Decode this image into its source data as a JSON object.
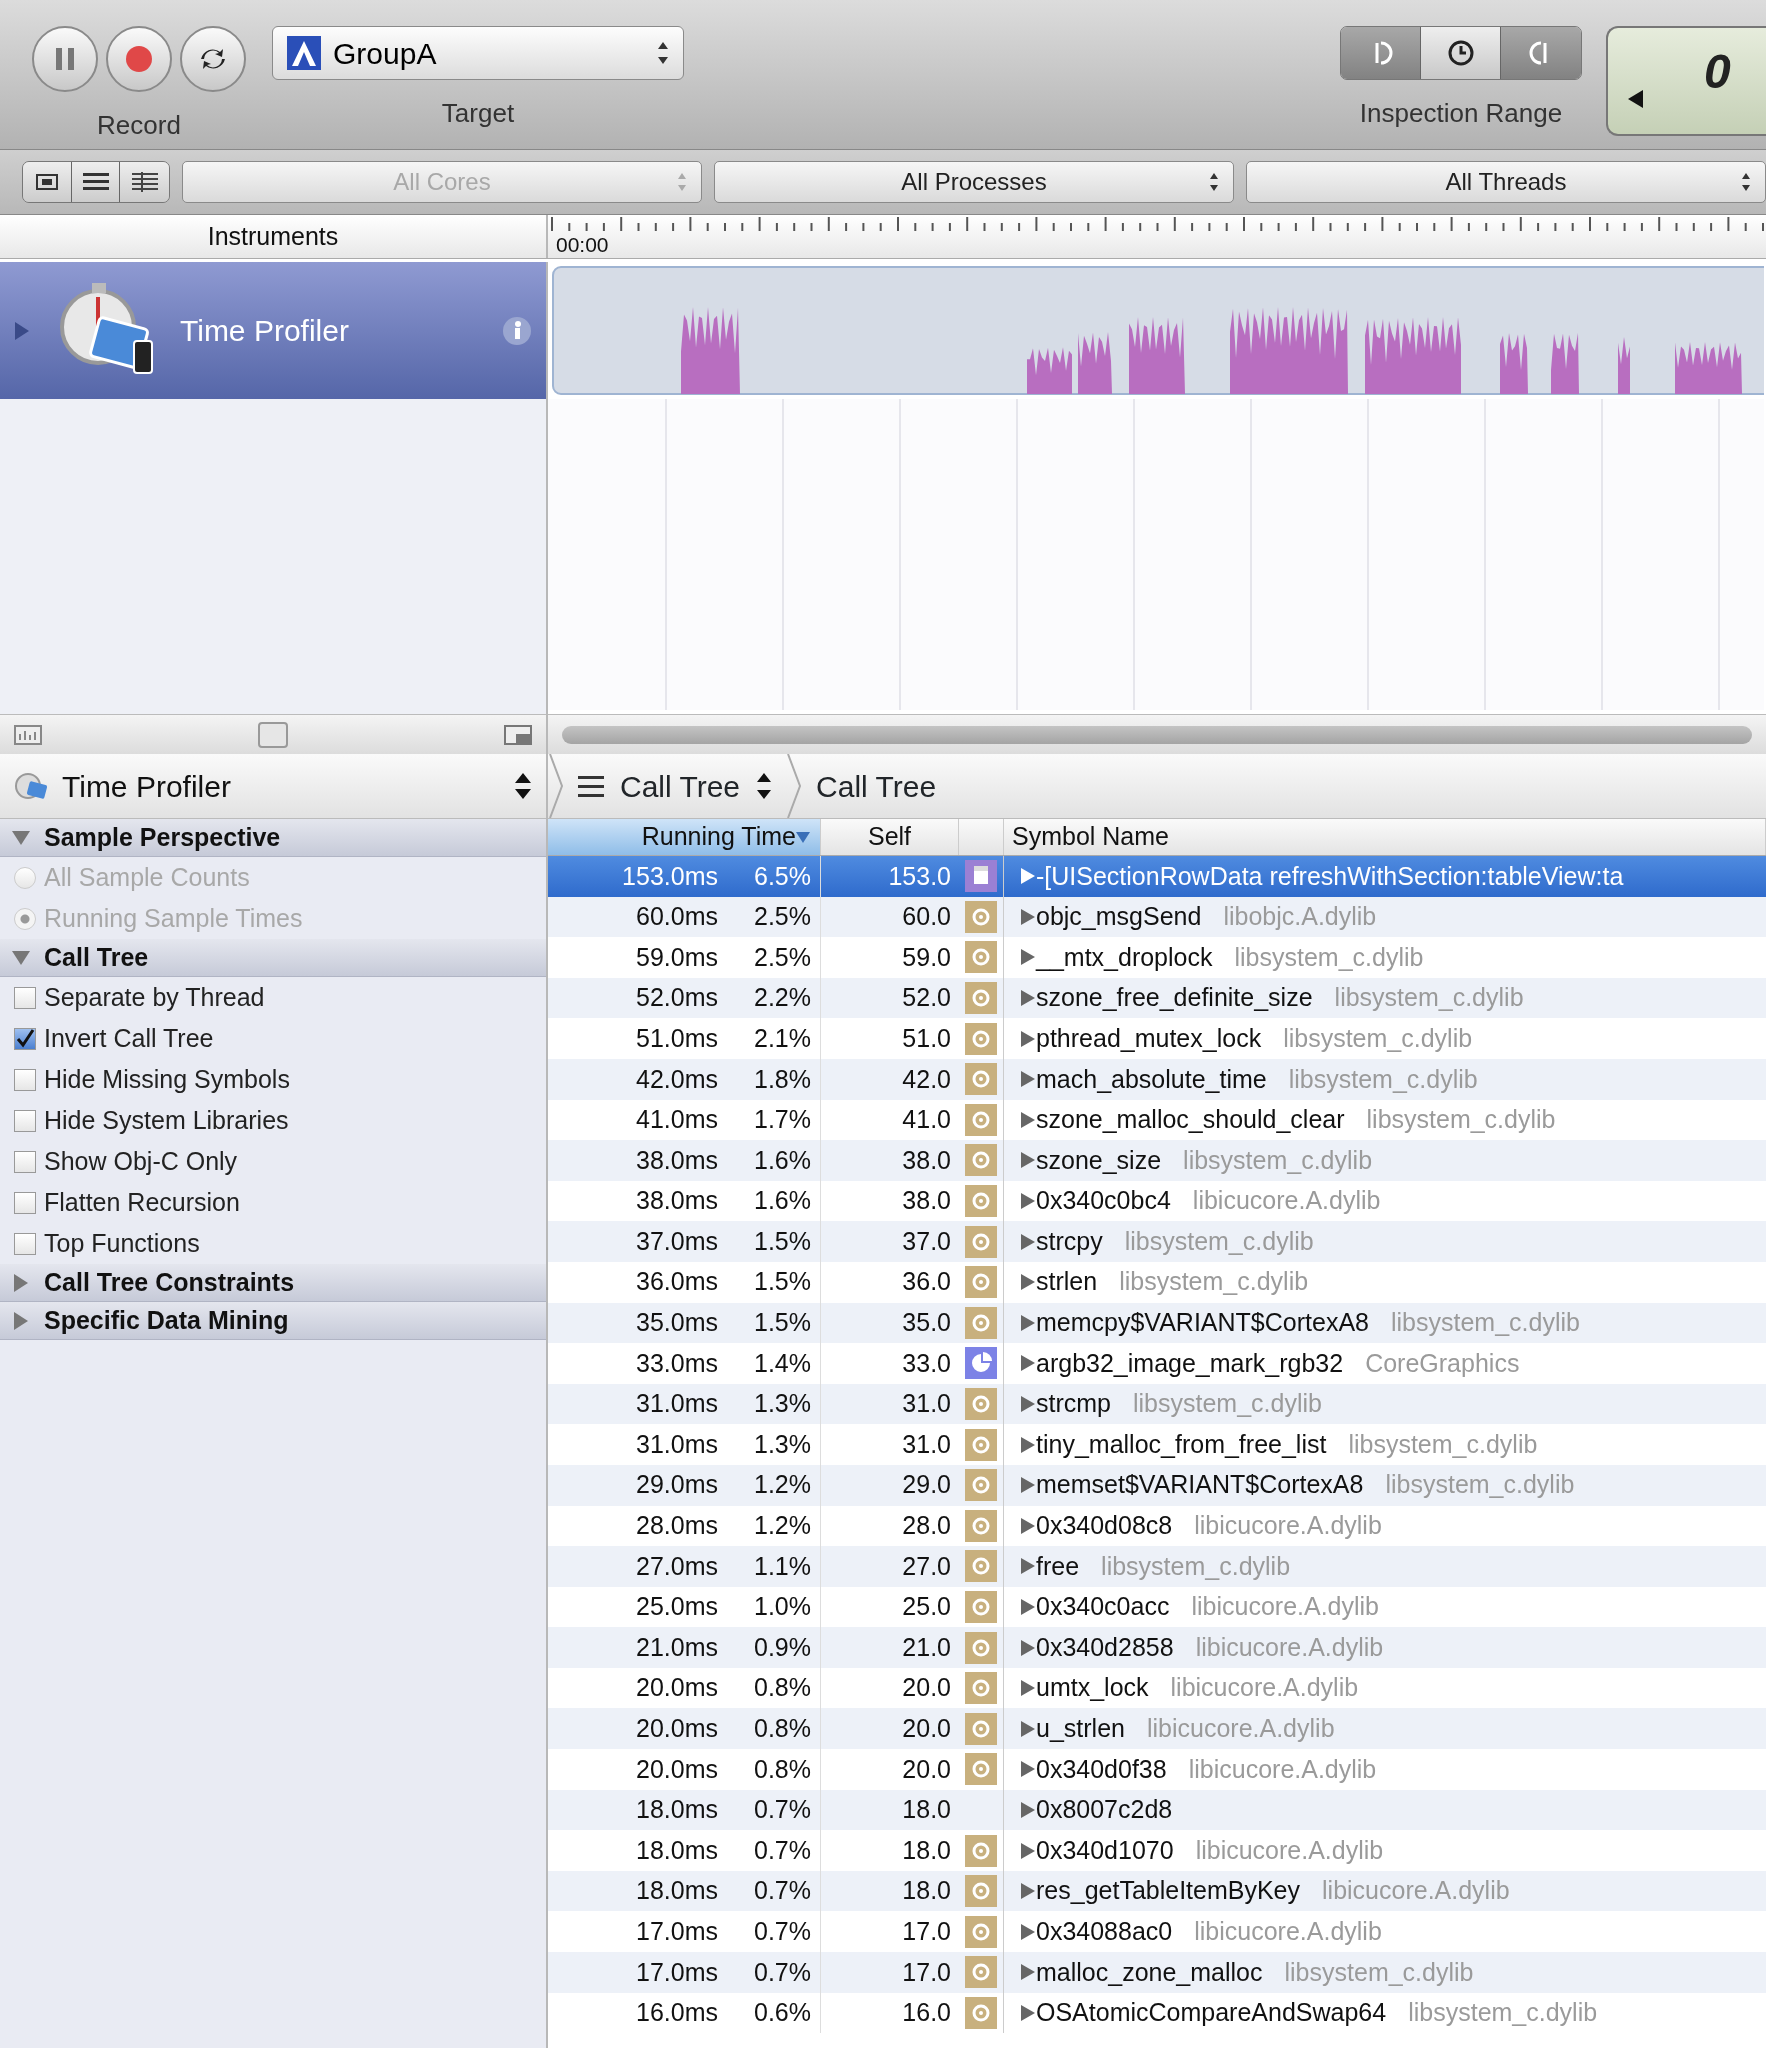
{
  "toolbar": {
    "record_label": "Record",
    "target": {
      "value": "GroupA",
      "label": "Target"
    },
    "inspection_range_label": "Inspection Range",
    "clock_display": "0"
  },
  "filters": [
    {
      "label": "All Cores",
      "disabled": true
    },
    {
      "label": "All Processes",
      "disabled": false
    },
    {
      "label": "All Threads",
      "disabled": false
    }
  ],
  "instruments_header": "Instruments",
  "timeline": {
    "start": "00:00"
  },
  "track": {
    "name": "Time Profiler",
    "selected": true
  },
  "detail_bar": {
    "instrument": "Time Profiler",
    "crumbs": [
      {
        "label": "Call Tree",
        "kind": "popup"
      },
      {
        "label": "Call Tree",
        "kind": "plain"
      }
    ]
  },
  "sidebar": {
    "sections": [
      {
        "title": "Sample Perspective",
        "expanded": true,
        "items": [
          {
            "kind": "radio",
            "label": "All Sample Counts",
            "selected": false,
            "disabled": true
          },
          {
            "kind": "radio",
            "label": "Running Sample Times",
            "selected": true,
            "disabled": true
          }
        ]
      },
      {
        "title": "Call Tree",
        "expanded": true,
        "items": [
          {
            "kind": "checkbox",
            "label": "Separate by Thread",
            "checked": false,
            "disabled": false
          },
          {
            "kind": "checkbox",
            "label": "Invert Call Tree",
            "checked": true,
            "disabled": false
          },
          {
            "kind": "checkbox",
            "label": "Hide Missing Symbols",
            "checked": false,
            "disabled": false
          },
          {
            "kind": "checkbox",
            "label": "Hide System Libraries",
            "checked": false,
            "disabled": false
          },
          {
            "kind": "checkbox",
            "label": "Show Obj-C Only",
            "checked": false,
            "disabled": false
          },
          {
            "kind": "checkbox",
            "label": "Flatten Recursion",
            "checked": false,
            "disabled": false
          },
          {
            "kind": "checkbox",
            "label": "Top Functions",
            "checked": false,
            "disabled": false
          }
        ]
      },
      {
        "title": "Call Tree Constraints",
        "expanded": false
      },
      {
        "title": "Specific Data Mining",
        "expanded": false
      }
    ]
  },
  "table": {
    "columns": [
      {
        "label": "Running Time",
        "sorted": true
      },
      {
        "label": "Self",
        "sorted": false
      },
      {
        "label": "Symbol Name",
        "sorted": false
      }
    ],
    "rows": [
      {
        "time": "153.0ms",
        "percent": "6.5%",
        "self": "153.0",
        "kind": "app",
        "symbol": "-[UISectionRowData refreshWithSection:tableView:ta",
        "selected": true
      },
      {
        "time": "60.0ms",
        "percent": "2.5%",
        "self": "60.0",
        "kind": "system",
        "symbol": "objc_msgSend",
        "library": "libobjc.A.dylib",
        "selected": false
      },
      {
        "time": "59.0ms",
        "percent": "2.5%",
        "self": "59.0",
        "kind": "system",
        "symbol": "__mtx_droplock",
        "library": "libsystem_c.dylib",
        "selected": false
      },
      {
        "time": "52.0ms",
        "percent": "2.2%",
        "self": "52.0",
        "kind": "system",
        "symbol": "szone_free_definite_size",
        "library": "libsystem_c.dylib",
        "selected": false
      },
      {
        "time": "51.0ms",
        "percent": "2.1%",
        "self": "51.0",
        "kind": "system",
        "symbol": "pthread_mutex_lock",
        "library": "libsystem_c.dylib",
        "selected": false
      },
      {
        "time": "42.0ms",
        "percent": "1.8%",
        "self": "42.0",
        "kind": "system",
        "symbol": "mach_absolute_time",
        "library": "libsystem_c.dylib",
        "selected": false
      },
      {
        "time": "41.0ms",
        "percent": "1.7%",
        "self": "41.0",
        "kind": "system",
        "symbol": "szone_malloc_should_clear",
        "library": "libsystem_c.dylib",
        "selected": false
      },
      {
        "time": "38.0ms",
        "percent": "1.6%",
        "self": "38.0",
        "kind": "system",
        "symbol": "szone_size",
        "library": "libsystem_c.dylib",
        "selected": false
      },
      {
        "time": "38.0ms",
        "percent": "1.6%",
        "self": "38.0",
        "kind": "system",
        "symbol": "0x340c0bc4",
        "library": "libicucore.A.dylib",
        "selected": false
      },
      {
        "time": "37.0ms",
        "percent": "1.5%",
        "self": "37.0",
        "kind": "system",
        "symbol": "strcpy",
        "library": "libsystem_c.dylib",
        "selected": false
      },
      {
        "time": "36.0ms",
        "percent": "1.5%",
        "self": "36.0",
        "kind": "system",
        "symbol": "strlen",
        "library": "libsystem_c.dylib",
        "selected": false
      },
      {
        "time": "35.0ms",
        "percent": "1.5%",
        "self": "35.0",
        "kind": "system",
        "symbol": "memcpy$VARIANT$CortexA8",
        "library": "libsystem_c.dylib",
        "selected": false
      },
      {
        "time": "33.0ms",
        "percent": "1.4%",
        "self": "33.0",
        "kind": "graphics",
        "symbol": "argb32_image_mark_rgb32",
        "library": "CoreGraphics",
        "selected": false
      },
      {
        "time": "31.0ms",
        "percent": "1.3%",
        "self": "31.0",
        "kind": "system",
        "symbol": "strcmp",
        "library": "libsystem_c.dylib",
        "selected": false
      },
      {
        "time": "31.0ms",
        "percent": "1.3%",
        "self": "31.0",
        "kind": "system",
        "symbol": "tiny_malloc_from_free_list",
        "library": "libsystem_c.dylib",
        "selected": false
      },
      {
        "time": "29.0ms",
        "percent": "1.2%",
        "self": "29.0",
        "kind": "system",
        "symbol": "memset$VARIANT$CortexA8",
        "library": "libsystem_c.dylib",
        "selected": false
      },
      {
        "time": "28.0ms",
        "percent": "1.2%",
        "self": "28.0",
        "kind": "system",
        "symbol": "0x340d08c8",
        "library": "libicucore.A.dylib",
        "selected": false
      },
      {
        "time": "27.0ms",
        "percent": "1.1%",
        "self": "27.0",
        "kind": "system",
        "symbol": "free",
        "library": "libsystem_c.dylib",
        "selected": false
      },
      {
        "time": "25.0ms",
        "percent": "1.0%",
        "self": "25.0",
        "kind": "system",
        "symbol": "0x340c0acc",
        "library": "libicucore.A.dylib",
        "selected": false
      },
      {
        "time": "21.0ms",
        "percent": "0.9%",
        "self": "21.0",
        "kind": "system",
        "symbol": "0x340d2858",
        "library": "libicucore.A.dylib",
        "selected": false
      },
      {
        "time": "20.0ms",
        "percent": "0.8%",
        "self": "20.0",
        "kind": "system",
        "symbol": "umtx_lock",
        "library": "libicucore.A.dylib",
        "selected": false
      },
      {
        "time": "20.0ms",
        "percent": "0.8%",
        "self": "20.0",
        "kind": "system",
        "symbol": "u_strlen",
        "library": "libicucore.A.dylib",
        "selected": false
      },
      {
        "time": "20.0ms",
        "percent": "0.8%",
        "self": "20.0",
        "kind": "system",
        "symbol": "0x340d0f38",
        "library": "libicucore.A.dylib",
        "selected": false
      },
      {
        "time": "18.0ms",
        "percent": "0.7%",
        "self": "18.0",
        "kind": "unknown",
        "symbol": "0x8007c2d8",
        "selected": false
      },
      {
        "time": "18.0ms",
        "percent": "0.7%",
        "self": "18.0",
        "kind": "system",
        "symbol": "0x340d1070",
        "library": "libicucore.A.dylib",
        "selected": false
      },
      {
        "time": "18.0ms",
        "percent": "0.7%",
        "self": "18.0",
        "kind": "system",
        "symbol": "res_getTableItemByKey",
        "library": "libicucore.A.dylib",
        "selected": false
      },
      {
        "time": "17.0ms",
        "percent": "0.7%",
        "self": "17.0",
        "kind": "system",
        "symbol": "0x34088ac0",
        "library": "libicucore.A.dylib",
        "selected": false
      },
      {
        "time": "17.0ms",
        "percent": "0.7%",
        "self": "17.0",
        "kind": "system",
        "symbol": "malloc_zone_malloc",
        "library": "libsystem_c.dylib",
        "selected": false
      },
      {
        "time": "16.0ms",
        "percent": "0.6%",
        "self": "16.0",
        "kind": "system",
        "symbol": "OSAtomicCompareAndSwap64",
        "library": "libsystem_c.dylib",
        "selected": false
      }
    ]
  }
}
